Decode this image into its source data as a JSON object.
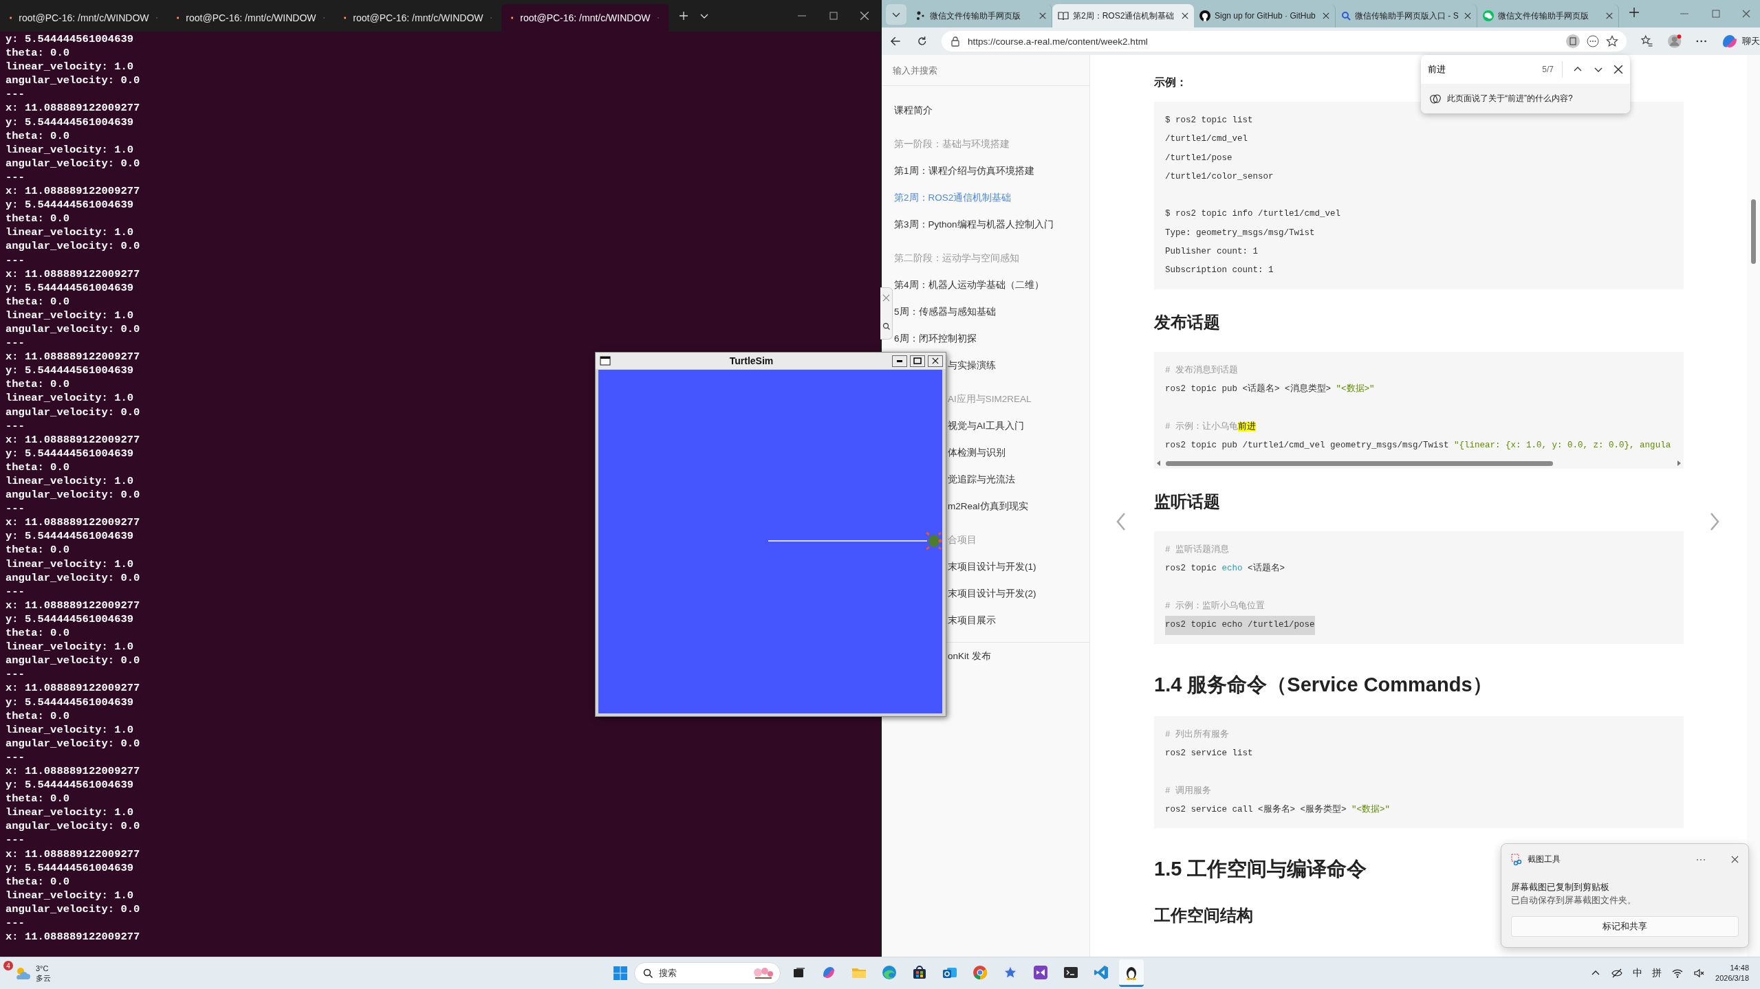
{
  "terminal": {
    "tabs": [
      {
        "title": "root@PC-16: /mnt/c/WINDOW",
        "selected": false
      },
      {
        "title": "root@PC-16: /mnt/c/WINDOW",
        "selected": false
      },
      {
        "title": "root@PC-16: /mnt/c/WINDOW",
        "selected": false
      },
      {
        "title": "root@PC-16: /mnt/c/WINDOW",
        "selected": true
      }
    ],
    "lines": [
      "y: 5.544444561004639",
      "theta: 0.0",
      "linear_velocity: 1.0",
      "angular_velocity: 0.0",
      "---",
      "x: 11.088889122009277",
      "y: 5.544444561004639",
      "theta: 0.0",
      "linear_velocity: 1.0",
      "angular_velocity: 0.0",
      "---",
      "x: 11.088889122009277",
      "y: 5.544444561004639",
      "theta: 0.0",
      "linear_velocity: 1.0",
      "angular_velocity: 0.0",
      "---",
      "x: 11.088889122009277",
      "y: 5.544444561004639",
      "theta: 0.0",
      "linear_velocity: 1.0",
      "angular_velocity: 0.0",
      "---",
      "x: 11.088889122009277",
      "y: 5.544444561004639",
      "theta: 0.0",
      "linear_velocity: 1.0",
      "angular_velocity: 0.0",
      "---",
      "x: 11.088889122009277",
      "y: 5.544444561004639",
      "theta: 0.0",
      "linear_velocity: 1.0",
      "angular_velocity: 0.0",
      "---",
      "x: 11.088889122009277",
      "y: 5.544444561004639",
      "theta: 0.0",
      "linear_velocity: 1.0",
      "angular_velocity: 0.0",
      "---",
      "x: 11.088889122009277",
      "y: 5.544444561004639",
      "theta: 0.0",
      "linear_velocity: 1.0",
      "angular_velocity: 0.0",
      "---",
      "x: 11.088889122009277",
      "y: 5.544444561004639",
      "theta: 0.0",
      "linear_velocity: 1.0",
      "angular_velocity: 0.0",
      "---",
      "x: 11.088889122009277",
      "y: 5.544444561004639",
      "theta: 0.0",
      "linear_velocity: 1.0",
      "angular_velocity: 0.0",
      "---",
      "x: 11.088889122009277",
      "y: 5.544444561004639",
      "theta: 0.0",
      "linear_velocity: 1.0",
      "angular_velocity: 0.0",
      "---",
      "x: 11.088889122009277"
    ]
  },
  "turtlesim": {
    "title": "TurtleSim"
  },
  "browser": {
    "tabs": [
      {
        "title": "微信文件传输助手网页版",
        "kind": "wechat-file",
        "selected": false
      },
      {
        "title": "第2周：ROS2通信机制基础",
        "kind": "book",
        "selected": true
      },
      {
        "title": "Sign up for GitHub · GitHub",
        "kind": "github",
        "selected": false
      },
      {
        "title": "微信传输助手网页版入口 - S",
        "kind": "search",
        "selected": false
      },
      {
        "title": "微信文件传输助手网页版",
        "kind": "wechat",
        "selected": false
      }
    ],
    "url": "https://course.a-real.me/content/week2.html",
    "chat_label": "聊天",
    "sidebar": {
      "search_placeholder": "输入并搜索",
      "items": [
        {
          "label": "课程简介",
          "kind": "link",
          "selected": false
        },
        {
          "label": "第一阶段：基础与环境搭建",
          "kind": "group",
          "selected": false
        },
        {
          "label": "第1周：课程介绍与仿真环境搭建",
          "kind": "link",
          "selected": false
        },
        {
          "label": "第2周：ROS2通信机制基础",
          "kind": "link",
          "selected": true
        },
        {
          "label": "第3周：Python编程与机器人控制入门",
          "kind": "link",
          "selected": false
        },
        {
          "label": "第二阶段：运动学与空间感知",
          "kind": "group",
          "selected": false
        },
        {
          "label": "第4周：机器人运动学基础（二维）",
          "kind": "link",
          "selected": false
        },
        {
          "label": "5周：传感器与感知基础",
          "kind": "link",
          "selected": false
        },
        {
          "label": "6周：闭环控制初探",
          "kind": "link",
          "selected": false
        },
        {
          "label": "与实操演练",
          "kind": "link",
          "selected": false,
          "covered": true
        },
        {
          "label": "AI应用与SIM2REAL",
          "kind": "group",
          "selected": false,
          "covered": true
        },
        {
          "label": "视觉与AI工具入门",
          "kind": "link",
          "selected": false,
          "covered": true
        },
        {
          "label": "体检测与识别",
          "kind": "link",
          "selected": false,
          "covered": true
        },
        {
          "label": "觉追踪与光流法",
          "kind": "link",
          "selected": false,
          "covered": true
        },
        {
          "label": "m2Real仿真到现实",
          "kind": "link",
          "selected": false,
          "covered": true
        },
        {
          "label": "合项目",
          "kind": "group",
          "selected": false,
          "covered": true
        },
        {
          "label": "末项目设计与开发(1)",
          "kind": "link",
          "selected": false,
          "covered": true
        },
        {
          "label": "末项目设计与开发(2)",
          "kind": "link",
          "selected": false,
          "covered": true
        },
        {
          "label": "末项目展示",
          "kind": "link",
          "selected": false,
          "covered": true
        },
        {
          "label": "onKit 发布",
          "kind": "footer",
          "selected": false,
          "covered": true
        }
      ]
    },
    "find": {
      "query": "前进",
      "count": "5/7",
      "ask": "此页面说了关于“前进”的什么内容?"
    },
    "content": [
      {
        "kind": "label",
        "text": "示例："
      },
      {
        "kind": "code",
        "lines": [
          {
            "kind": "text",
            "segments": [
              {
                "text": "$ ros2 topic list",
                "kind": "plain"
              }
            ]
          },
          {
            "kind": "text",
            "segments": [
              {
                "text": "/turtle1/cmd_vel",
                "kind": "plain"
              }
            ]
          },
          {
            "kind": "text",
            "segments": [
              {
                "text": "/turtle1/pose",
                "kind": "plain"
              }
            ]
          },
          {
            "kind": "text",
            "segments": [
              {
                "text": "/turtle1/color_sensor",
                "kind": "plain"
              }
            ]
          },
          {
            "kind": "blank"
          },
          {
            "kind": "text",
            "segments": [
              {
                "text": "$ ros2 topic info /turtle1/cmd_vel",
                "kind": "plain"
              }
            ]
          },
          {
            "kind": "text",
            "segments": [
              {
                "text": "Type: geometry_msgs/msg/Twist",
                "kind": "plain"
              }
            ]
          },
          {
            "kind": "text",
            "segments": [
              {
                "text": "Publisher count: 1",
                "kind": "plain"
              }
            ]
          },
          {
            "kind": "text",
            "segments": [
              {
                "text": "Subscription count: 1",
                "kind": "plain"
              }
            ]
          }
        ]
      },
      {
        "kind": "h3",
        "text": "发布话题"
      },
      {
        "kind": "code",
        "scrollable": true,
        "lines": [
          {
            "kind": "text",
            "segments": [
              {
                "text": "# 发布消息到话题",
                "kind": "comment"
              }
            ]
          },
          {
            "kind": "text",
            "segments": [
              {
                "text": "ros2 topic pub <话题名> <消息类型> ",
                "kind": "plain"
              },
              {
                "text": "\"<数据>\"",
                "kind": "string"
              }
            ]
          },
          {
            "kind": "blank"
          },
          {
            "kind": "text",
            "segments": [
              {
                "text": "# 示例：让小乌龟",
                "kind": "comment"
              },
              {
                "text": "前进",
                "kind": "match"
              }
            ]
          },
          {
            "kind": "text",
            "segments": [
              {
                "text": "ros2 topic pub /turtle1/cmd_vel geometry_msgs/msg/Twist ",
                "kind": "plain"
              },
              {
                "text": "\"{linear: {x: 1.0, y: 0.0, z: 0.0}, angula",
                "kind": "string"
              }
            ]
          }
        ]
      },
      {
        "kind": "h3",
        "text": "监听话题"
      },
      {
        "kind": "code",
        "lines": [
          {
            "kind": "text",
            "segments": [
              {
                "text": "# 监听话题消息",
                "kind": "comment"
              }
            ]
          },
          {
            "kind": "text",
            "segments": [
              {
                "text": "ros2 topic ",
                "kind": "plain"
              },
              {
                "text": "echo",
                "kind": "keyword"
              },
              {
                "text": " <话题名>",
                "kind": "plain"
              }
            ]
          },
          {
            "kind": "blank"
          },
          {
            "kind": "text",
            "segments": [
              {
                "text": "# 示例：监听小乌龟位置",
                "kind": "comment"
              }
            ]
          },
          {
            "kind": "selected",
            "segments": [
              {
                "text": "ros2 topic echo /turtle1/pose",
                "kind": "plain"
              }
            ]
          }
        ]
      },
      {
        "kind": "h2",
        "text": "1.4 服务命令（Service Commands）"
      },
      {
        "kind": "code",
        "lines": [
          {
            "kind": "text",
            "segments": [
              {
                "text": "# 列出所有服务",
                "kind": "comment"
              }
            ]
          },
          {
            "kind": "text",
            "segments": [
              {
                "text": "ros2 service list",
                "kind": "plain"
              }
            ]
          },
          {
            "kind": "blank"
          },
          {
            "kind": "text",
            "segments": [
              {
                "text": "# 调用服务",
                "kind": "comment"
              }
            ]
          },
          {
            "kind": "text",
            "segments": [
              {
                "text": "ros2 service call <服务名> <服务类型> ",
                "kind": "plain"
              },
              {
                "text": "\"<数据>\"",
                "kind": "string"
              }
            ]
          }
        ]
      },
      {
        "kind": "h2",
        "text": "1.5 工作空间与编译命令"
      },
      {
        "kind": "h3",
        "text": "工作空间结构"
      }
    ]
  },
  "notification": {
    "app": "截图工具",
    "title": "屏幕截图已复制到剪贴板",
    "body": "已自动保存到屏幕截图文件夹。",
    "action": "标记和共享"
  },
  "taskbar": {
    "weather_badge": "4",
    "temperature": "3°C",
    "condition": "多云",
    "search_label": "搜索",
    "apps": [
      {
        "kind": "task-view",
        "active": false
      },
      {
        "kind": "copilot",
        "active": false
      },
      {
        "kind": "folder",
        "active": false
      },
      {
        "kind": "edge",
        "active": false
      },
      {
        "kind": "store",
        "active": false
      },
      {
        "kind": "mail",
        "active": false
      },
      {
        "kind": "chrome",
        "active": false
      },
      {
        "kind": "star",
        "active": false
      },
      {
        "kind": "studio",
        "active": false
      },
      {
        "kind": "terminal",
        "active": false
      },
      {
        "kind": "vscode",
        "active": false
      },
      {
        "kind": "penguin",
        "active": true
      }
    ],
    "ime_mode": "中",
    "ime_name": "拼",
    "time": "14:48",
    "date": "2026/3/18"
  }
}
